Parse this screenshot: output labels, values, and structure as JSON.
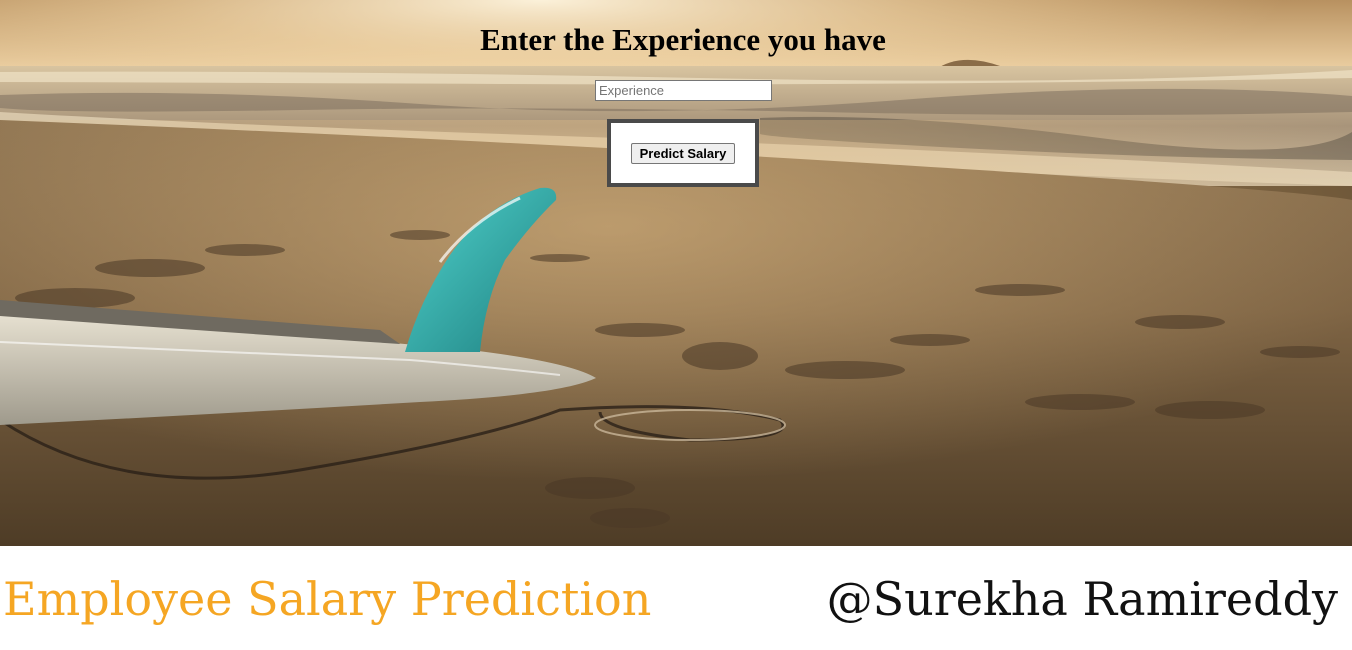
{
  "form": {
    "heading": "Enter the Experience you have",
    "experience_placeholder": "Experience",
    "experience_value": "",
    "submit_label": "Predict Salary"
  },
  "footer": {
    "title": "Employee Salary Prediction",
    "author": "@Surekha Ramireddy"
  },
  "background": {
    "scene": "beach at sunset with surfboard and fin on sand",
    "colors": {
      "sky": "#f3d6a4",
      "sea": "#b9a58a",
      "sand": "#7a6040",
      "fin": "#2fa3a2"
    }
  },
  "colors": {
    "footer_title": "#f5a623",
    "footer_author": "#111111",
    "button_box_border": "#4a4a4a"
  }
}
